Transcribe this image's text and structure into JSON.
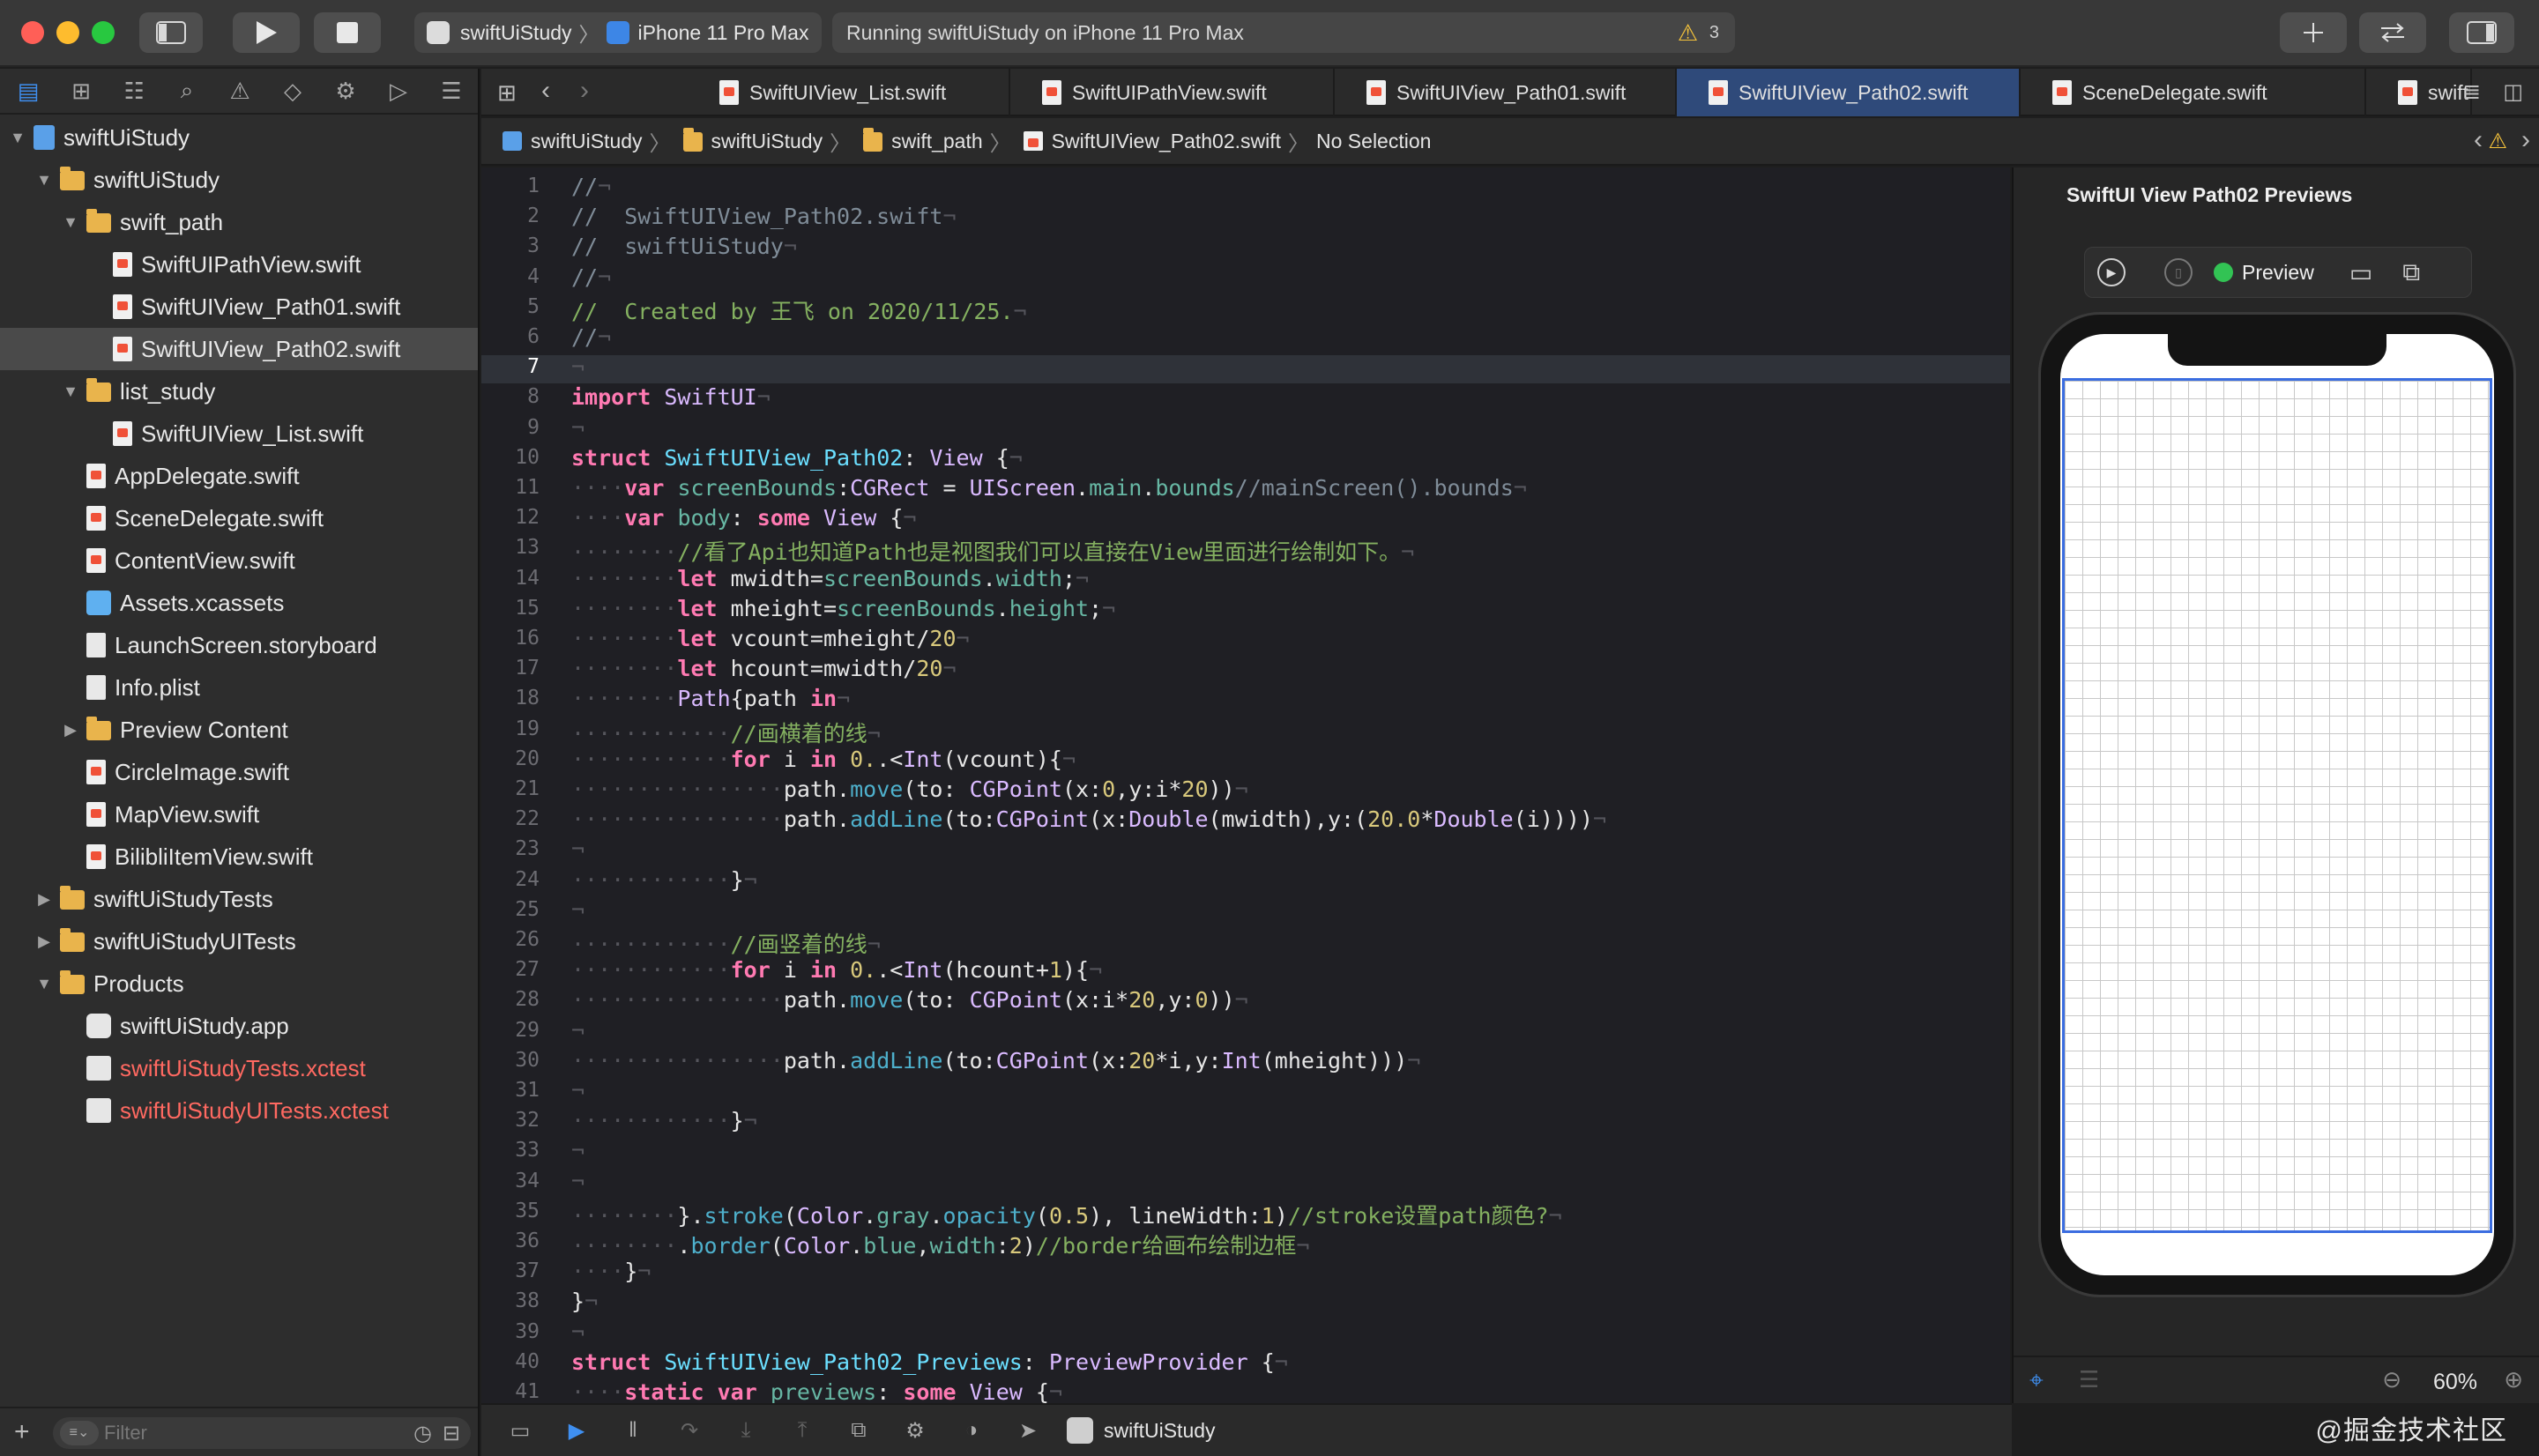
{
  "titlebar": {
    "scheme": "swiftUiStudy",
    "device": "iPhone 11 Pro Max",
    "status": "Running swiftUiStudy on iPhone 11 Pro Max",
    "warning_count": "3"
  },
  "navigator": {
    "tree": [
      {
        "label": "swiftUiStudy",
        "icon": "project",
        "level": 0,
        "disclosure": "down"
      },
      {
        "label": "swiftUiStudy",
        "icon": "folder",
        "level": 1,
        "disclosure": "down"
      },
      {
        "label": "swift_path",
        "icon": "folder",
        "level": 2,
        "disclosure": "down"
      },
      {
        "label": "SwiftUIPathView.swift",
        "icon": "swift",
        "level": 3
      },
      {
        "label": "SwiftUIView_Path01.swift",
        "icon": "swift",
        "level": 3
      },
      {
        "label": "SwiftUIView_Path02.swift",
        "icon": "swift",
        "level": 3,
        "selected": true
      },
      {
        "label": "list_study",
        "icon": "folder",
        "level": 2,
        "disclosure": "down"
      },
      {
        "label": "SwiftUIView_List.swift",
        "icon": "swift",
        "level": 3
      },
      {
        "label": "AppDelegate.swift",
        "icon": "swift",
        "level": 2
      },
      {
        "label": "SceneDelegate.swift",
        "icon": "swift",
        "level": 2
      },
      {
        "label": "ContentView.swift",
        "icon": "swift",
        "level": 2
      },
      {
        "label": "Assets.xcassets",
        "icon": "assets",
        "level": 2
      },
      {
        "label": "LaunchScreen.storyboard",
        "icon": "plist",
        "level": 2
      },
      {
        "label": "Info.plist",
        "icon": "plist",
        "level": 2
      },
      {
        "label": "Preview Content",
        "icon": "folder",
        "level": 2,
        "disclosure": "right"
      },
      {
        "label": "CircleImage.swift",
        "icon": "swift",
        "level": 2
      },
      {
        "label": "MapView.swift",
        "icon": "swift",
        "level": 2
      },
      {
        "label": "BilibliItemView.swift",
        "icon": "swift",
        "level": 2
      },
      {
        "label": "swiftUiStudyTests",
        "icon": "folder",
        "level": 1,
        "disclosure": "right"
      },
      {
        "label": "swiftUiStudyUITests",
        "icon": "folder",
        "level": 1,
        "disclosure": "right"
      },
      {
        "label": "Products",
        "icon": "folder",
        "level": 1,
        "disclosure": "down"
      },
      {
        "label": "swiftUiStudy.app",
        "icon": "app",
        "level": 2
      },
      {
        "label": "swiftUiStudyTests.xctest",
        "icon": "xctest",
        "level": 2,
        "missing": true
      },
      {
        "label": "swiftUiStudyUITests.xctest",
        "icon": "xctest",
        "level": 2,
        "missing": true
      }
    ],
    "filter_placeholder": "Filter"
  },
  "tabs": [
    {
      "label": "SwiftUIView_List.swift"
    },
    {
      "label": "SwiftUIPathView.swift"
    },
    {
      "label": "SwiftUIView_Path01.swift"
    },
    {
      "label": "SwiftUIView_Path02.swift",
      "active": true
    },
    {
      "label": "SceneDelegate.swift"
    },
    {
      "label": "swiftUiStu"
    }
  ],
  "jumpbar": {
    "crumbs": [
      "swiftUiStudy",
      "swiftUiStudy",
      "swift_path",
      "SwiftUIView_Path02.swift",
      "No Selection"
    ]
  },
  "editor": {
    "current_line": 7,
    "lines": [
      "//",
      "//  SwiftUIView_Path02.swift",
      "//  swiftUiStudy",
      "//",
      "//  Created by 王飞 on 2020/11/25.",
      "//",
      "",
      "import SwiftUI",
      "",
      "struct SwiftUIView_Path02: View {",
      "    var screenBounds:CGRect = UIScreen.main.bounds//mainScreen().bounds",
      "    var body: some View {",
      "        //看了Api也知道Path也是视图我们可以直接在View里面进行绘制如下。",
      "        let mwidth=screenBounds.width;",
      "        let mheight=screenBounds.height;",
      "        let vcount=mheight/20",
      "        let hcount=mwidth/20",
      "        Path{path in",
      "            //画横着的线",
      "            for i in 0..<Int(vcount){",
      "                path.move(to: CGPoint(x:0,y:i*20))",
      "                path.addLine(to:CGPoint(x:Double(mwidth),y:(20.0*Double(i))))",
      "",
      "            }",
      "",
      "            //画竖着的线",
      "            for i in 0..<Int(hcount+1){",
      "                path.move(to: CGPoint(x:i*20,y:0))",
      "",
      "                path.addLine(to:CGPoint(x:20*i,y:Int(mheight)))",
      "",
      "            }",
      "",
      "",
      "        }.stroke(Color.gray.opacity(0.5), lineWidth:1)//stroke设置path颜色?",
      "        .border(Color.blue,width:2)//border给画布绘制边框",
      "    }",
      "}",
      "",
      "struct SwiftUIView_Path02_Previews: PreviewProvider {",
      "    static var previews: some View {"
    ]
  },
  "canvas": {
    "title": "SwiftUI View Path02 Previews",
    "preview_label": "Preview",
    "zoom": "60%"
  },
  "debugbar": {
    "target": "swiftUiStudy"
  },
  "watermark": "@掘金技术社区",
  "colors": {
    "accent": "#2f4a7a",
    "keyword": "#ff7ab2",
    "comment": "#7f8c98",
    "grid_border": "#3b6de0",
    "missing_file": "#ff6961"
  }
}
